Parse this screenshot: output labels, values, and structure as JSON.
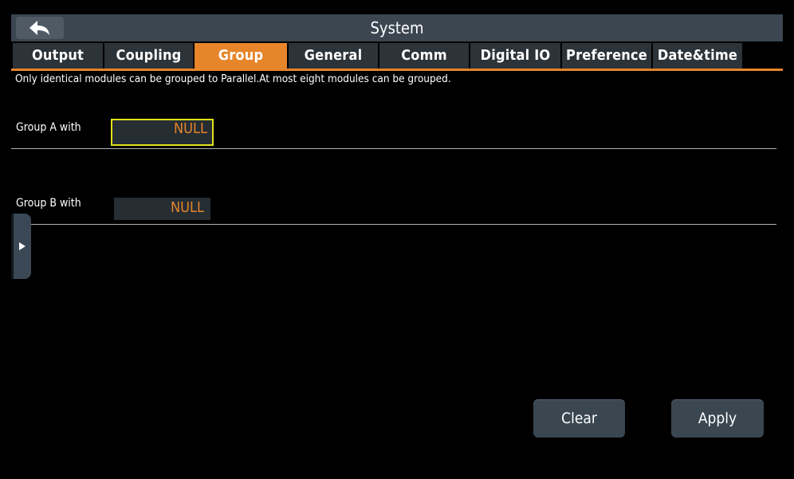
{
  "title": "System",
  "back": {
    "icon": "back-arrow-icon"
  },
  "tabs": [
    {
      "label": "Output",
      "active": false
    },
    {
      "label": "Coupling",
      "active": false
    },
    {
      "label": "Group",
      "active": true
    },
    {
      "label": "General",
      "active": false
    },
    {
      "label": "Comm",
      "active": false
    },
    {
      "label": "Digital IO",
      "active": false
    },
    {
      "label": "Preference",
      "active": false
    },
    {
      "label": "Date&time",
      "active": false
    }
  ],
  "note": "Only identical modules can be grouped to Parallel.At most eight modules can be grouped.",
  "group_a": {
    "label": "Group A with",
    "value": "NULL"
  },
  "group_b": {
    "label": "Group B with",
    "value": "NULL"
  },
  "buttons": {
    "clear": "Clear",
    "apply": "Apply"
  },
  "colors": {
    "accent": "#e6852a",
    "focus": "#e1e11a",
    "titlebar": "#3b4651",
    "tab_bg": "#2c3339"
  }
}
